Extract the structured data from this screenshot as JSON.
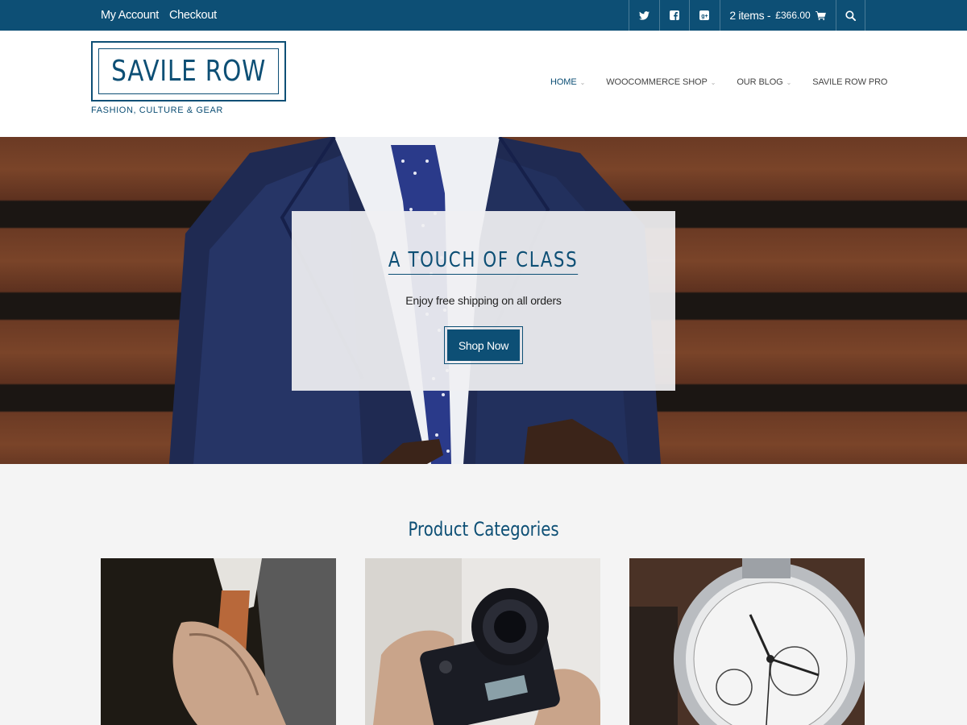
{
  "topbar": {
    "my_account": "My Account",
    "checkout": "Checkout",
    "cart_items": "2 items -",
    "cart_total": "£366.00",
    "icons": [
      "twitter-icon",
      "facebook-icon",
      "google-plus-icon",
      "cart-icon",
      "search-icon"
    ]
  },
  "header": {
    "logo": "SAVILE ROW",
    "tagline": "FASHION, CULTURE & GEAR",
    "nav": [
      {
        "label": "HOME",
        "dropdown": true,
        "active": true
      },
      {
        "label": "WOOCOMMERCE SHOP",
        "dropdown": true
      },
      {
        "label": "OUR BLOG",
        "dropdown": true
      },
      {
        "label": "SAVILE ROW PRO",
        "dropdown": false
      }
    ]
  },
  "hero": {
    "title": "A TOUCH OF CLASS",
    "subtitle": "Enjoy free shipping on all orders",
    "button": "Shop Now"
  },
  "categories": {
    "title": "Product Categories"
  },
  "colors": {
    "brand": "#0d4f75",
    "background": "#f4f4f4"
  }
}
